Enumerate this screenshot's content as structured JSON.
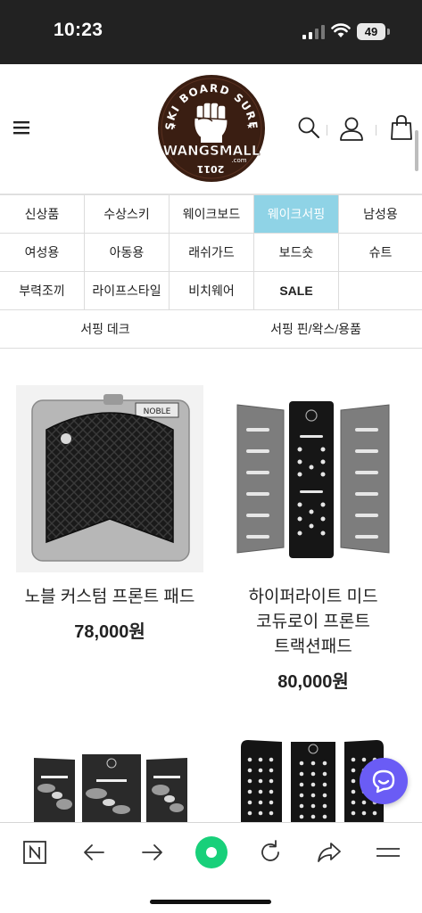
{
  "status_bar": {
    "time": "10:23",
    "battery": "49"
  },
  "header": {
    "logo_top_text": "SKI BOARD SURF",
    "logo_brand": "WANGSMALL",
    "logo_suffix": ".com",
    "logo_year": "2011"
  },
  "categories": {
    "rows": [
      [
        {
          "label": "신상품"
        },
        {
          "label": "수상스키"
        },
        {
          "label": "웨이크보드"
        },
        {
          "label": "웨이크서핑",
          "active": true
        },
        {
          "label": "남성용"
        }
      ],
      [
        {
          "label": "여성용"
        },
        {
          "label": "아동용"
        },
        {
          "label": "래쉬가드"
        },
        {
          "label": "보드숏"
        },
        {
          "label": "슈트"
        }
      ],
      [
        {
          "label": "부력조끼"
        },
        {
          "label": "라이프스타일"
        },
        {
          "label": "비치웨어"
        },
        {
          "label": "SALE"
        },
        {
          "label": ""
        }
      ]
    ],
    "active_color": "#8fd3e6"
  },
  "subcategories": [
    "서핑 데크",
    "서핑 핀/왁스/용품"
  ],
  "products": [
    {
      "name": "노블 커스텀 프론트 패드",
      "price": "78,000원"
    },
    {
      "name_lines": [
        "하이퍼라이트 미드",
        "코듀로이 프론트",
        "트랙션패드"
      ],
      "price": "80,000원"
    }
  ],
  "product_images": {
    "noble_label": "NOBLE"
  },
  "icons": {
    "menu": "hamburger-icon",
    "search": "search-icon",
    "user": "user-icon",
    "cart": "shopping-bag-icon",
    "chat": "chat-icon",
    "browser": [
      "n-tab-icon",
      "back-arrow-icon",
      "forward-arrow-icon",
      "home-dot-icon",
      "reload-icon",
      "share-icon",
      "menu-lines-icon"
    ]
  },
  "colors": {
    "chat": "#6a5cf5",
    "browser_home": "#18d07a"
  }
}
